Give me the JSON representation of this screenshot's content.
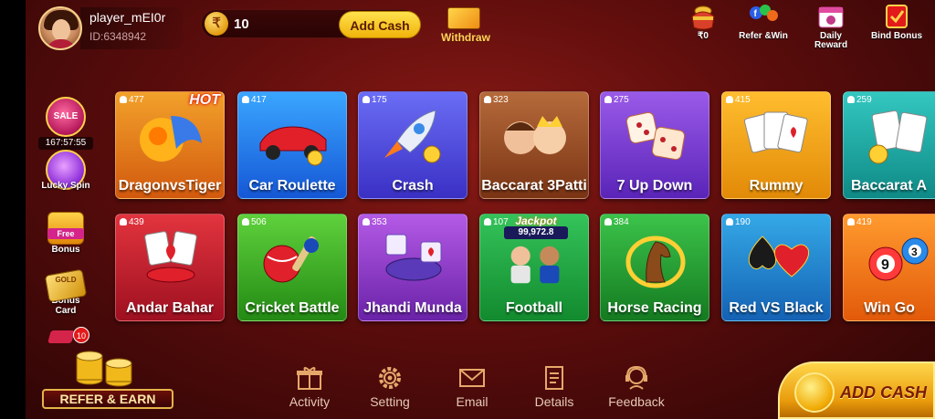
{
  "player": {
    "name": "player_mEI0r",
    "id": "ID:6348942"
  },
  "balance": {
    "currency_symbol": "₹",
    "amount": "10",
    "add_cash_label": "Add Cash"
  },
  "withdraw": {
    "label": "Withdraw"
  },
  "top_actions": [
    {
      "icon": "pot-icon",
      "label": "₹0"
    },
    {
      "icon": "share-icon",
      "label": "Refer &Win"
    },
    {
      "icon": "gift-calendar-icon",
      "label": "Daily Reward"
    },
    {
      "icon": "checkbox-icon",
      "label": "Bind Bonus"
    }
  ],
  "side": {
    "sale": {
      "label": "SALE",
      "timer": "167:57:55"
    },
    "lucky_spin": {
      "label": "Lucky Spin"
    },
    "free_bonus": {
      "label": "Bonus",
      "tag": "Free"
    },
    "bonus_card": {
      "label": "Bonus Card",
      "tag": "GOLD"
    },
    "mail_badge": "10"
  },
  "games_row1": [
    {
      "title": "DragonvsTiger",
      "players": "477",
      "hot": "HOT",
      "color_a": "#f2a12b",
      "color_b": "#d2590e"
    },
    {
      "title": "Car Roulette",
      "players": "417",
      "color_a": "#3aa6ff",
      "color_b": "#1557d6"
    },
    {
      "title": "Crash",
      "players": "175",
      "color_a": "#6a6df5",
      "color_b": "#3a30c4"
    },
    {
      "title": "Baccarat 3Patti",
      "players": "323",
      "color_a": "#b56a3a",
      "color_b": "#7a3414"
    },
    {
      "title": "7 Up Down",
      "players": "275",
      "color_a": "#9a5ae8",
      "color_b": "#5a24b8"
    },
    {
      "title": "Rummy",
      "players": "415",
      "color_a": "#ffbd2e",
      "color_b": "#e28a08"
    },
    {
      "title": "Baccarat A",
      "players": "259",
      "color_a": "#33c7c0",
      "color_b": "#0f8a86"
    }
  ],
  "games_row2": [
    {
      "title": "Andar Bahar",
      "players": "439",
      "color_a": "#e2343e",
      "color_b": "#9e1020"
    },
    {
      "title": "Cricket Battle",
      "players": "506",
      "color_a": "#5fd13c",
      "color_b": "#238a14"
    },
    {
      "title": "Jhandi Munda",
      "players": "353",
      "color_a": "#b45ae6",
      "color_b": "#6a22a8"
    },
    {
      "title": "Football",
      "players": "107",
      "jackpot_title": "Jackpot",
      "jackpot_value": "99,972.8",
      "color_a": "#34c35a",
      "color_b": "#128a2e"
    },
    {
      "title": "Horse Racing",
      "players": "384",
      "color_a": "#3cc34a",
      "color_b": "#147a20"
    },
    {
      "title": "Red VS Black",
      "players": "190",
      "color_a": "#34a8e6",
      "color_b": "#1462b4"
    },
    {
      "title": "Win Go",
      "players": "419",
      "color_a": "#ff9a2e",
      "color_b": "#e25a0a"
    }
  ],
  "refer_earn": {
    "label": "REFER & EARN"
  },
  "bottom_nav": [
    {
      "icon": "gift-box-icon",
      "label": "Activity"
    },
    {
      "icon": "gear-icon",
      "label": "Setting"
    },
    {
      "icon": "envelope-icon",
      "label": "Email"
    },
    {
      "icon": "document-icon",
      "label": "Details"
    },
    {
      "icon": "support-agent-icon",
      "label": "Feedback"
    }
  ],
  "add_cash_big": {
    "label": "ADD CASH"
  }
}
